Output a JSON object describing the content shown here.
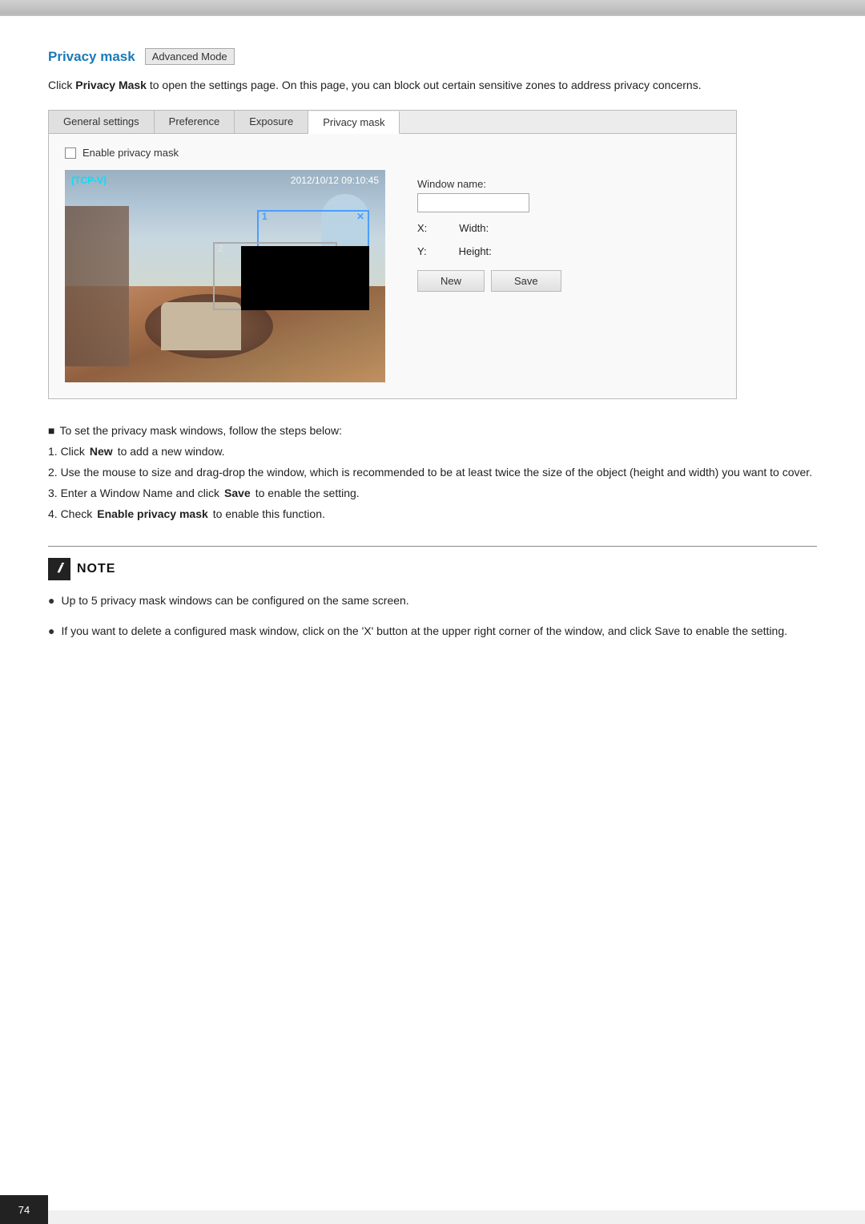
{
  "page": {
    "number": "74"
  },
  "heading": {
    "title": "Privacy mask",
    "badge": "Advanced Mode"
  },
  "description": {
    "text_before_bold": "Click ",
    "bold1": "Privacy Mask",
    "text_middle": " to open the settings page. On this page, you can block out certain sensitive zones to address privacy concerns."
  },
  "tabs": {
    "items": [
      {
        "label": "General settings",
        "active": false
      },
      {
        "label": "Preference",
        "active": false
      },
      {
        "label": "Exposure",
        "active": false
      },
      {
        "label": "Privacy mask",
        "active": true
      }
    ]
  },
  "panel": {
    "checkbox_label": "Enable privacy mask",
    "camera_label": "(TCP-V)",
    "camera_timestamp": "2012/10/12 09:10:45",
    "mask1_number": "1",
    "mask1_close": "✕",
    "mask2_number": "2",
    "mask2_close": "✕",
    "controls": {
      "window_name_label": "Window name:",
      "window_name_placeholder": "",
      "x_label": "X:",
      "x_value": "",
      "width_label": "Width:",
      "width_value": "",
      "y_label": "Y:",
      "y_value": "",
      "height_label": "Height:",
      "height_value": ""
    },
    "buttons": {
      "new_label": "New",
      "save_label": "Save"
    }
  },
  "steps": {
    "bullet": "To set the privacy mask windows, follow the steps below:",
    "items": [
      {
        "num": "1.",
        "text_before": "Click ",
        "bold": "New",
        "text_after": " to add a new window."
      },
      {
        "num": "2.",
        "text_before": "Use the mouse to size and drag-drop the window, which is recommended to be at least twice the size of the object (height and width) you want to cover."
      },
      {
        "num": "3.",
        "text_before": "Enter a Window Name and click ",
        "bold": "Save",
        "text_after": " to enable the setting."
      },
      {
        "num": "4.",
        "text_before": "Check ",
        "bold": "Enable privacy mask",
        "text_after": " to enable this function."
      }
    ]
  },
  "note": {
    "icon": "🖊",
    "title": "NOTE",
    "items": [
      "Up to 5 privacy mask windows can be configured on the same screen.",
      "If you want to delete a configured mask window, click on the 'X' button at the upper right corner of the window, and click Save to enable the setting."
    ]
  }
}
